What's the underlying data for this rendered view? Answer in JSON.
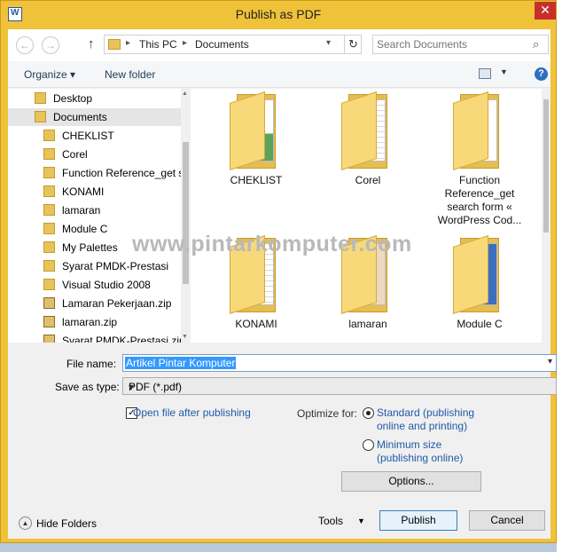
{
  "window": {
    "title": "Publish as PDF",
    "close_glyph": "✕"
  },
  "nav": {
    "back_glyph": "←",
    "forward_glyph": "→",
    "up_glyph": "↑",
    "breadcrumbs": [
      "This PC",
      "Documents"
    ],
    "refresh_glyph": "↻",
    "search_placeholder": "Search Documents",
    "search_glyph": "⌕"
  },
  "toolbar": {
    "organize_label": "Organize ▾",
    "new_folder_label": "New folder",
    "help_glyph": "?"
  },
  "tree": {
    "items": [
      {
        "label": "Desktop",
        "kind": "folder",
        "level": 1
      },
      {
        "label": "Documents",
        "kind": "folder",
        "level": 1,
        "selected": true
      },
      {
        "label": "CHEKLIST",
        "kind": "folder",
        "level": 2
      },
      {
        "label": "Corel",
        "kind": "folder",
        "level": 2
      },
      {
        "label": "Function Reference_get s",
        "kind": "folder",
        "level": 2
      },
      {
        "label": "KONAMI",
        "kind": "folder",
        "level": 2
      },
      {
        "label": "lamaran",
        "kind": "folder",
        "level": 2
      },
      {
        "label": "Module C",
        "kind": "folder",
        "level": 2
      },
      {
        "label": "My Palettes",
        "kind": "folder",
        "level": 2
      },
      {
        "label": "Syarat PMDK-Prestasi",
        "kind": "folder",
        "level": 2
      },
      {
        "label": "Visual Studio 2008",
        "kind": "folder",
        "level": 2
      },
      {
        "label": "Lamaran Pekerjaan.zip",
        "kind": "zip",
        "level": 2
      },
      {
        "label": "lamaran.zip",
        "kind": "zip",
        "level": 2
      },
      {
        "label": "Syarat PMDK-Prestasi.zip",
        "kind": "zip",
        "level": 2
      }
    ]
  },
  "files": [
    {
      "label": "CHEKLIST",
      "thumb": "excel"
    },
    {
      "label": "Corel",
      "thumb": "docs"
    },
    {
      "label": "Function Reference_get search form « WordPress Cod...",
      "thumb": "plain"
    },
    {
      "label": "KONAMI",
      "thumb": "docs"
    },
    {
      "label": "lamaran",
      "thumb": "cert"
    },
    {
      "label": "Module C",
      "thumb": "blue"
    }
  ],
  "watermark": "www.pintarkomputer.com",
  "form": {
    "file_name_label": "File name:",
    "file_name_value": "Artikel Pintar Komputer",
    "save_type_label": "Save as type:",
    "save_type_value": "PDF (*.pdf)",
    "open_after_label": "Open file after publishing",
    "open_after_checked": true,
    "optimize_label": "Optimize for:",
    "standard_label_1": "Standard (publishing",
    "standard_label_2": "online and printing)",
    "minimum_label_1": "Minimum size",
    "minimum_label_2": "(publishing online)",
    "optimize_selected": "standard",
    "options_label": "Options...",
    "dropdown_glyph": "▾",
    "check_glyph": "✓"
  },
  "footer": {
    "hide_folders_label": "Hide Folders",
    "hide_folders_glyph": "▲",
    "tools_label": "Tools",
    "tools_glyph": "▼",
    "publish_label": "Publish",
    "cancel_label": "Cancel"
  }
}
